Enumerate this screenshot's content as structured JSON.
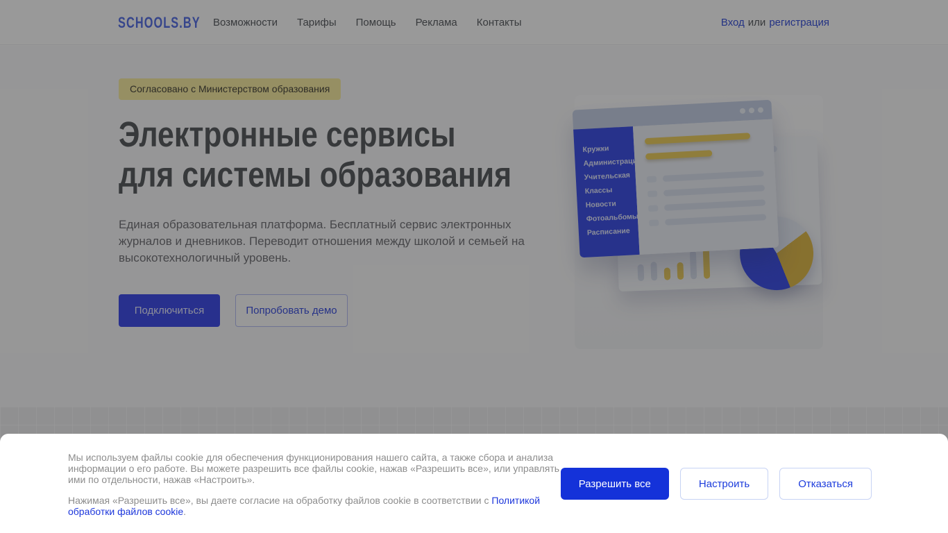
{
  "brand": {
    "logo": "SCHOOLS.BY"
  },
  "header": {
    "nav": [
      "Возможности",
      "Тарифы",
      "Помощь",
      "Реклама",
      "Контакты"
    ],
    "auth": {
      "login": "Вход",
      "or": "или",
      "register": "регистрация"
    }
  },
  "hero": {
    "badge": "Согласовано с Министерством образования",
    "title_line1": "Электронные сервисы",
    "title_line2": "для системы образования",
    "description": "Единая образовательная платформа. Бесплатный сервис электронных журналов и дневников. Переводит отношения между школой и семьей на высокотехнологичный уровень.",
    "primary_button": "Подключиться",
    "secondary_button": "Попробовать демо"
  },
  "illustration": {
    "menu_items": [
      "Кружки",
      "Администрация",
      "Учительская",
      "Классы",
      "Новости",
      "Фотоальбомы",
      "Расписание"
    ]
  },
  "cookie_banner": {
    "paragraph1": "Мы используем файлы cookie для обеспечения функционирования нашего сайта, а также сбора и анализа информации о его работе. Вы можете разрешить все файлы cookie, нажав «Разрешить все», или управлять ими по отдельности, нажав «Настроить».",
    "paragraph2_prefix": "Нажимая «Разрешить все», вы даете согласие на обработку файлов cookie в соответствии с ",
    "paragraph2_link": "Политикой обработки файлов cookie",
    "paragraph2_suffix": ".",
    "buttons": {
      "allow": "Разрешить все",
      "configure": "Настроить",
      "decline": "Отказаться"
    }
  },
  "colors": {
    "primary_blue": "#4350EC",
    "cookie_blue": "#1432D9",
    "link_blue": "#3D55DC",
    "badge_yellow": "#FBEFA5",
    "sidebar_blue": "#4254E8",
    "accent_yellow": "#EFD063"
  }
}
